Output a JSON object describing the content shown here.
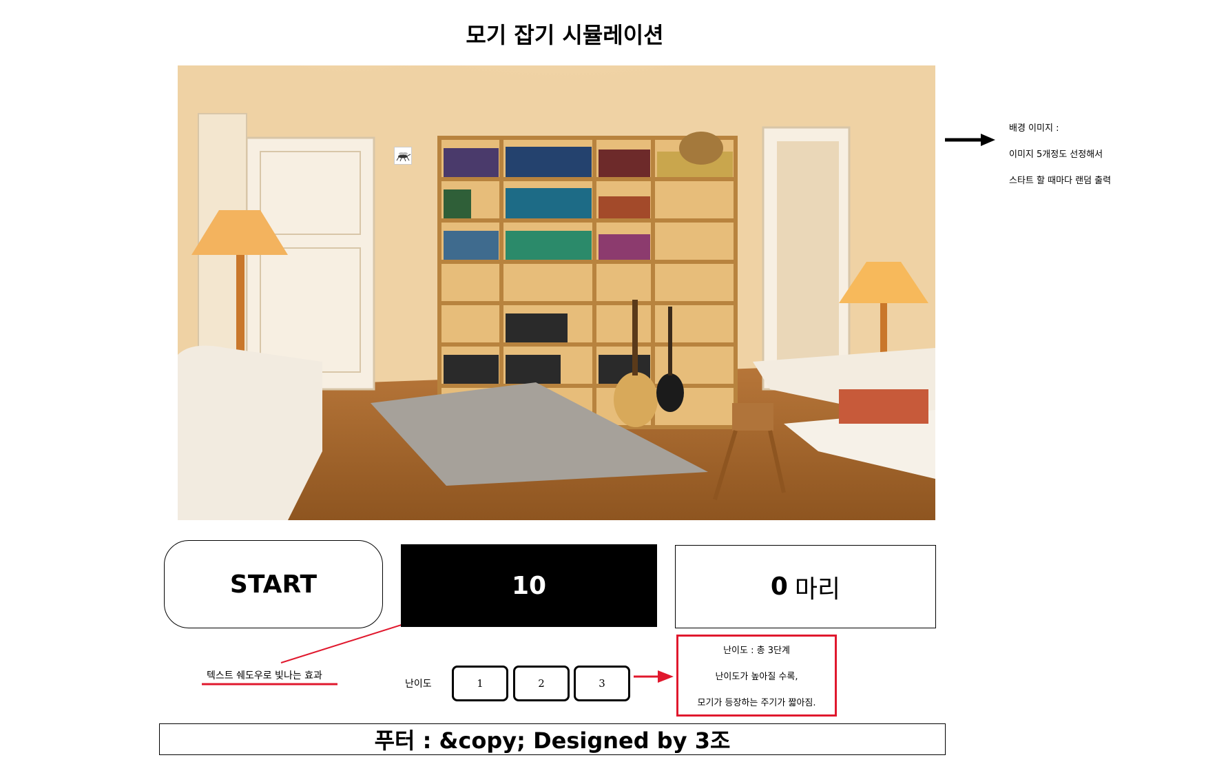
{
  "title": "모기 잡기 시뮬레이션",
  "note": {
    "line1": "배경 이미지 :",
    "line2": "이미지 5개정도 선정해서",
    "line3": "스타트 할 때마다 랜덤 출력"
  },
  "controls": {
    "start_label": "START",
    "timer_value": "10",
    "score_count": "0",
    "score_unit": "마리"
  },
  "annotations": {
    "shadow_effect": "텍스트 쉐도우로 빛나는 효과"
  },
  "difficulty": {
    "label": "난이도",
    "levels": [
      "1",
      "2",
      "3"
    ],
    "note_line1": "난이도 : 총 3단계",
    "note_line2": "난이도가 높아질 수록,",
    "note_line3": "모기가 등장하는 주기가 짧아짐."
  },
  "footer": {
    "text": "푸터 : &copy; Designed by 3조"
  },
  "colors": {
    "annotation_red": "#e0182d",
    "timer_bg": "#000000"
  },
  "icons": {
    "mosquito": "mosquito-icon",
    "arrow": "right-arrow-icon"
  }
}
